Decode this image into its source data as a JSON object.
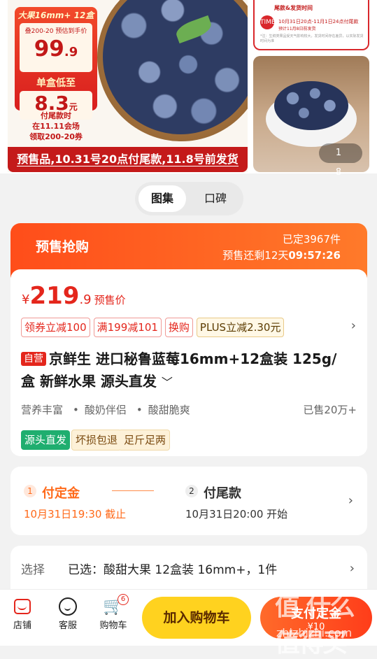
{
  "gallery": {
    "promo_top": "大果16mm+ 12盒",
    "promo_sub": "叠200-20 预估到手价",
    "promo_price": "99",
    "promo_price_dec": ".9",
    "per_box_label": "单盒低至",
    "per_box_price": "8.3",
    "per_box_unit": "元",
    "note_line1": "付尾款时",
    "note_line2": "在11.11会场",
    "note_line3": "领取200-20券",
    "banner": "预售品,10.31号20点付尾款,11.8号前发货",
    "thumb_title": "尾款&发货时间",
    "thumb_line1": "10月31日20点-11月1日24点付尾款",
    "thumb_line2": "预计11月8日前发货",
    "thumb_logo": "TIME",
    "thumb_body": "*注：生鲜类果品受天气影响较大，发货时间存在差异，以实际发货时间为准",
    "counter": "1 8"
  },
  "tabs": {
    "active": "图集",
    "other": "口碑"
  },
  "presale": {
    "title": "预售抢购",
    "booked": "已定3967件",
    "remain_prefix": "预售还剩12天",
    "remain_time": "09:57:26",
    "price_symbol": "¥",
    "price_int": "219",
    "price_dec": ".9",
    "price_tag": "预售价",
    "coupons": [
      "领券立减100",
      "满199减101",
      "换购",
      "PLUS立减2.30元"
    ],
    "coupon_arrow": "›",
    "self_tag": "自营",
    "product_title": "京鲜生 进口秘鲁蓝莓16mm+12盒装 125g/盒 新鲜水果 源头直发",
    "title_arrow": "﹀",
    "features": [
      "营养丰富",
      "酸奶伴侣",
      "酸甜脆爽"
    ],
    "feature_sep": "•",
    "sold": "已售20万+",
    "badges": [
      "源头直发",
      "坏损包退",
      "足斤足两"
    ]
  },
  "steps": {
    "step1_num": "1",
    "step1_title": "付定金",
    "step1_time": "10月31日19:30 截止",
    "step2_num": "2",
    "step2_title": "付尾款",
    "step2_time": "10月31日20:00 开始",
    "arrow": "›"
  },
  "selection": {
    "label": "选择",
    "value": "已选：酸甜大果 12盒装  16mm+，1件",
    "arrow": "›"
  },
  "bottom_bar": {
    "shop": "店铺",
    "service": "客服",
    "cart": "购物车",
    "cart_count": "6",
    "add_to_cart": "加入购物车",
    "pay_deposit": "支付定金",
    "pay_amount": "¥10"
  },
  "watermark": {
    "main": "值 什么值得买",
    "sub": "zhizhizhi.com"
  },
  "colors": {
    "accent_red": "#e4261c",
    "accent_orange": "#ff6a1a",
    "cart_yellow": "#ffd21f",
    "green_badge": "#1fae6f"
  }
}
